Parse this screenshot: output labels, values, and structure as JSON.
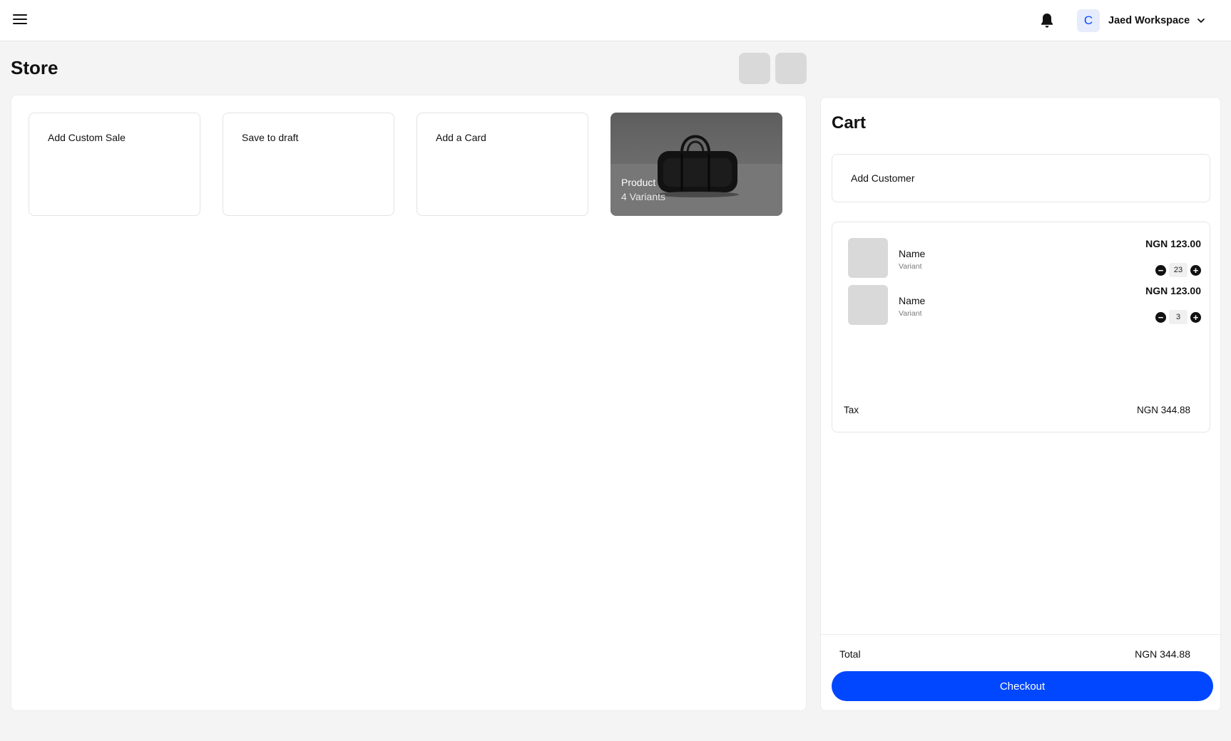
{
  "header": {
    "menu_icon": "menu-icon",
    "notification_icon": "bell-icon",
    "workspace": {
      "initial": "C",
      "name": "Jaed Workspace",
      "icon": "chevron-down-icon"
    }
  },
  "page": {
    "title": "Store"
  },
  "store": {
    "tiles": [
      {
        "label": "Add Custom Sale"
      },
      {
        "label": "Save to draft"
      },
      {
        "label": "Add a Card"
      }
    ],
    "product": {
      "name": "Product",
      "variants": "4 Variants"
    }
  },
  "cart": {
    "title": "Cart",
    "add_customer": "Add Customer",
    "items": [
      {
        "name": "Name",
        "variant": "Variant",
        "price": "NGN 123.00",
        "qty": "23"
      },
      {
        "name": "Name",
        "variant": "Variant",
        "price": "NGN 123.00",
        "qty": "3"
      }
    ],
    "tax_label": "Tax",
    "tax_value": "NGN 344.88",
    "total_label": "Total",
    "total_value": "NGN 344.88",
    "checkout_label": "Checkout",
    "accent_color": "#0047ff"
  }
}
